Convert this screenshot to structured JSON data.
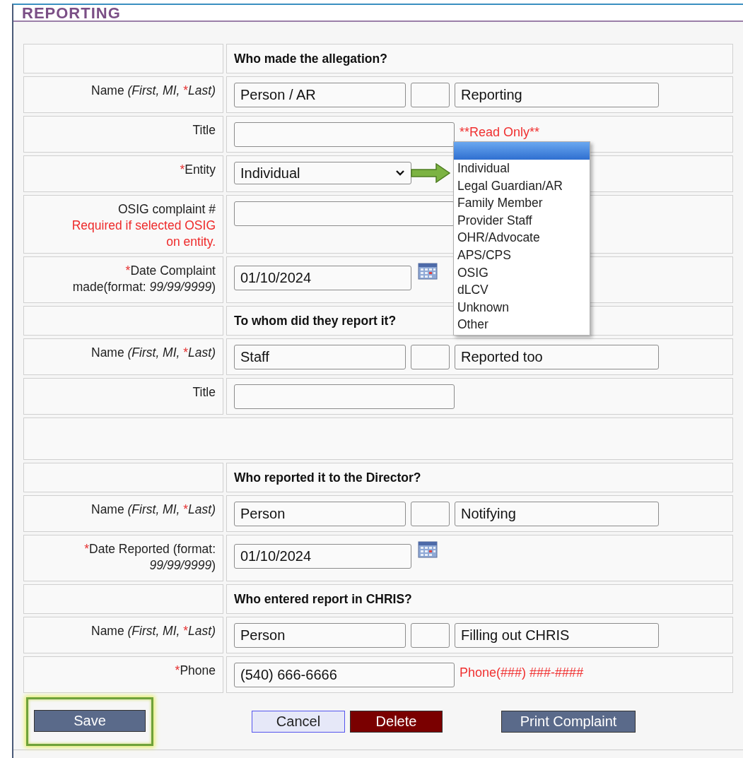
{
  "title": "REPORTING",
  "rows": [
    {
      "kind": "heading",
      "text": "Who made the allegation?"
    },
    {
      "kind": "name",
      "label": [
        {
          "text": "Name ",
          "kind": "plain"
        },
        {
          "text": "(First, MI, ",
          "kind": "emphasis"
        },
        {
          "text": "*",
          "kind": "required"
        },
        {
          "text": "Last)",
          "kind": "emphasis"
        }
      ],
      "first": "Person / AR",
      "last": "Reporting"
    },
    {
      "kind": "text",
      "label": [
        {
          "text": "Title",
          "kind": "plain"
        }
      ],
      "note": "**Read Only**"
    },
    {
      "kind": "select",
      "label": [
        {
          "text": "*",
          "kind": "required"
        },
        {
          "text": "Entity",
          "kind": "plain"
        }
      ],
      "value": "Individual",
      "expanded": true,
      "options": [
        "Individual",
        "Legal Guardian/AR",
        "Family Member",
        "Provider Staff",
        "OHR/Advocate",
        "APS/CPS",
        "OSIG",
        "dLCV",
        "Unknown",
        "Other"
      ]
    },
    {
      "kind": "text",
      "label": [
        {
          "text": "OSIG complaint #",
          "kind": "plain"
        },
        {
          "text": "Required if selected OSIG on entity.",
          "kind": "warning"
        }
      ]
    },
    {
      "kind": "date",
      "label": [
        {
          "text": "*",
          "kind": "required"
        },
        {
          "text": "Date Complaint made(format: ",
          "kind": "plain"
        },
        {
          "text": "99/99/9999",
          "kind": "emphasis"
        },
        {
          "text": ")",
          "kind": "plain"
        }
      ],
      "value": "01/10/2024"
    },
    {
      "kind": "heading",
      "text": "To whom did they report it?"
    },
    {
      "kind": "name",
      "label": [
        {
          "text": "Name ",
          "kind": "plain"
        },
        {
          "text": "(First, MI, ",
          "kind": "emphasis"
        },
        {
          "text": "*",
          "kind": "required"
        },
        {
          "text": "Last)",
          "kind": "emphasis"
        }
      ],
      "first": "Staff",
      "last": "Reported too"
    },
    {
      "kind": "text",
      "label": [
        {
          "text": "Title",
          "kind": "plain"
        }
      ]
    },
    {
      "kind": "blank"
    },
    {
      "kind": "heading",
      "text": "Who reported it to the Director?"
    },
    {
      "kind": "name",
      "label": [
        {
          "text": "Name ",
          "kind": "plain"
        },
        {
          "text": "(First, MI, ",
          "kind": "emphasis"
        },
        {
          "text": "*",
          "kind": "required"
        },
        {
          "text": "Last)",
          "kind": "emphasis"
        }
      ],
      "first": "Person",
      "last": "Notifying"
    },
    {
      "kind": "date",
      "label": [
        {
          "text": "*",
          "kind": "required"
        },
        {
          "text": "Date Reported (format: ",
          "kind": "plain"
        },
        {
          "text": "99/99/9999",
          "kind": "emphasis"
        },
        {
          "text": ")",
          "kind": "plain"
        }
      ],
      "value": "01/10/2024"
    },
    {
      "kind": "heading",
      "text": "Who entered report in CHRIS?"
    },
    {
      "kind": "name",
      "label": [
        {
          "text": "Name ",
          "kind": "plain"
        },
        {
          "text": "(First, MI, ",
          "kind": "emphasis"
        },
        {
          "text": "*",
          "kind": "required"
        },
        {
          "text": "Last)",
          "kind": "emphasis"
        }
      ],
      "first": "Person",
      "last": "Filling out CHRIS"
    },
    {
      "kind": "text",
      "label": [
        {
          "text": "*",
          "kind": "required"
        },
        {
          "text": "Phone",
          "kind": "plain"
        }
      ],
      "value": "(540) 666-6666",
      "note": "Phone(###) ###-####"
    }
  ],
  "buttons": [
    {
      "label": "Save",
      "kind": "primary",
      "highlighted": true
    },
    {
      "label": "Cancel",
      "kind": "secondary",
      "highlighted": false
    },
    {
      "label": "Delete",
      "kind": "danger",
      "highlighted": false
    },
    {
      "label": "Print Complaint",
      "kind": "primary",
      "highlighted": false
    }
  ]
}
